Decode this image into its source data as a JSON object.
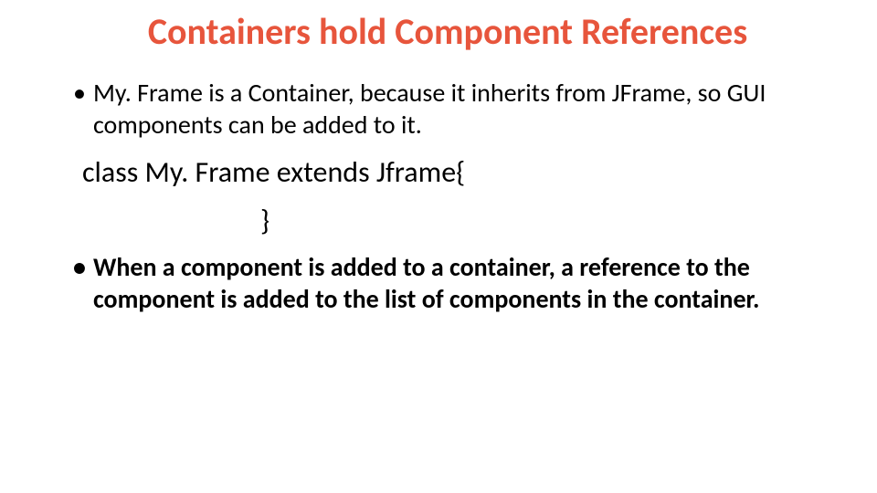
{
  "title": "Containers hold Component References",
  "bullets": [
    {
      "text": "My. Frame is a Container, because it inherits from JFrame, so GUI components can be added to it.",
      "bold": false
    }
  ],
  "code_line": "class My. Frame extends Jframe{",
  "code_close": "}",
  "bullets2": [
    {
      "text": "When a component is added to a container, a reference to the component is added to the list of components in the container.",
      "bold": true
    }
  ]
}
